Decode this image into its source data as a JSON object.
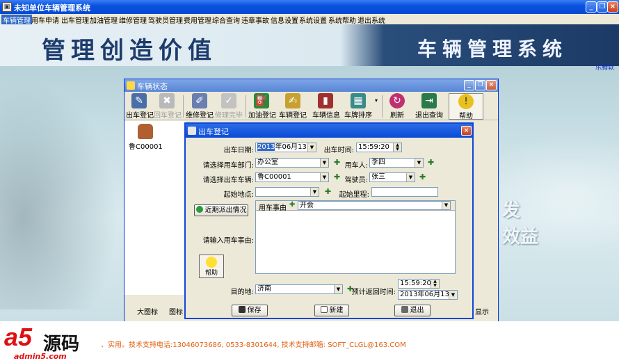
{
  "app": {
    "title": "未知单位车辆管理系统"
  },
  "menu": [
    "车辆管理",
    "用车申请",
    "出车管理",
    "加油管理",
    "维修管理",
    "驾驶员管理",
    "费用管理",
    "综合查询",
    "违章事故",
    "信息设置",
    "系统设置",
    "系统帮助",
    "退出系统"
  ],
  "banner": {
    "left_text": "管理创造价值",
    "right_text": "车辆管理系统",
    "sub": "乐腾软"
  },
  "slogan": {
    "line1": "发",
    "line2": "效益"
  },
  "vehicle_window": {
    "title": "车辆状态",
    "toolbar": [
      {
        "label": "出车登记",
        "icon": "car-out-icon",
        "enabled": true
      },
      {
        "label": "回车登记",
        "icon": "car-return-icon",
        "enabled": false
      },
      {
        "label": "维修登记",
        "icon": "repair-icon",
        "enabled": true
      },
      {
        "label": "修理完毕",
        "icon": "repair-done-icon",
        "enabled": false
      },
      {
        "label": "加油登记",
        "icon": "fuel-icon",
        "enabled": true
      },
      {
        "label": "车辆登记",
        "icon": "register-icon",
        "enabled": true
      },
      {
        "label": "车辆信息",
        "icon": "chart-icon",
        "enabled": true
      },
      {
        "label": "车牌排序",
        "icon": "sort-icon",
        "enabled": true
      },
      {
        "label": "刷新",
        "icon": "refresh-icon",
        "enabled": true
      },
      {
        "label": "退出查询",
        "icon": "exit-door-icon",
        "enabled": true
      },
      {
        "label": "帮助",
        "icon": "help-bulb-icon",
        "enabled": true
      }
    ],
    "cars": [
      {
        "plate": "鲁C00001"
      }
    ],
    "bottom": {
      "big_icon": "大图标",
      "icon_partial": "图标",
      "right_partial": "显示"
    }
  },
  "dialog": {
    "title": "出车登记",
    "out_date_label": "出车日期:",
    "out_date_hl": "2013",
    "out_date_rest": "年06月13日",
    "out_time_label": "出车时间:",
    "out_time": "15:59:20",
    "dept_label": "请选择用车部门:",
    "dept": "办公室",
    "user_label": "用车人:",
    "user": "李四",
    "car_label": "请选择出车车辆:",
    "car": "鲁C00001",
    "driver_label": "驾驶员:",
    "driver": "张三",
    "start_place_label": "起始地点:",
    "start_place": "",
    "start_mileage_label": "起始里程:",
    "start_mileage": "",
    "recent_btn": "近期派出情况",
    "reason_header": "用车事由",
    "reason_value": "开会",
    "reason_prompt": "请输入用车事由:",
    "help_label": "帮助",
    "dest_label": "目的地:",
    "dest": "济南",
    "return_label": "预计返回时间:",
    "return_time": "15:59:20",
    "return_date": "2013年06月13日",
    "save_btn": "保存",
    "new_btn": "新建",
    "exit_btn": "退出"
  },
  "footer": {
    "logo_big": "a5",
    "logo_cn": "源码",
    "logo_domain": "admin5.com",
    "support": "、实用。技术支持电话:13046073686, 0533-8301644, 技术支持邮箱: SOFT_CLGL@163.COM"
  }
}
